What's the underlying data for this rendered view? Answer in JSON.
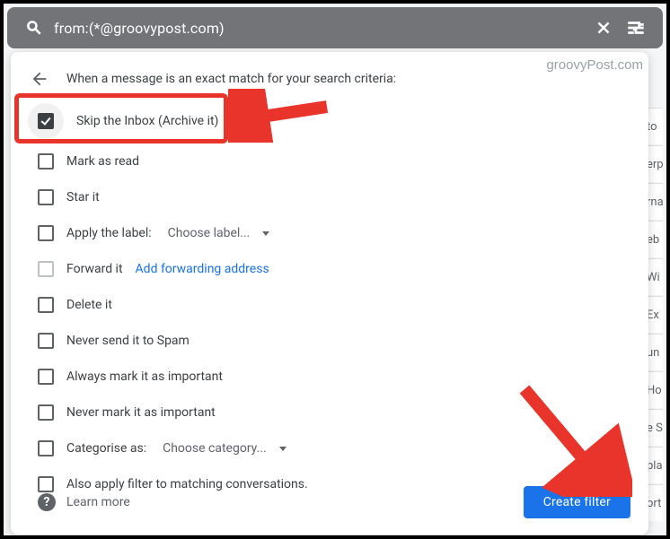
{
  "watermark": "groovyPost.com",
  "search": {
    "query": "from:(*@groovypost.com)"
  },
  "panel": {
    "heading": "When a message is an exact match for your search criteria:",
    "options": {
      "skip_inbox": "Skip the Inbox (Archive it)",
      "mark_read": "Mark as read",
      "star": "Star it",
      "apply_label_prefix": "Apply the label:",
      "apply_label_dropdown": "Choose label...",
      "forward_prefix": "Forward it",
      "forward_link": "Add forwarding address",
      "delete": "Delete it",
      "never_spam": "Never send it to Spam",
      "always_important": "Always mark it as important",
      "never_important": "Never mark it as important",
      "categorise_prefix": "Categorise as:",
      "categorise_dropdown": "Choose category...",
      "apply_existing": "Also apply filter to matching conversations."
    },
    "learn_more": "Learn more",
    "create_filter": "Create filter"
  },
  "bg_rows": [
    "to",
    "erp",
    "rna",
    "eb",
    "Wi",
    "Ex",
    "un",
    "Ho",
    "e S",
    "pla",
    "ort"
  ]
}
